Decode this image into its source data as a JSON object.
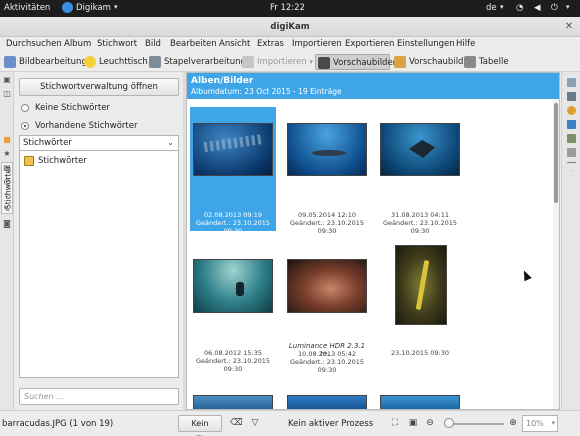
{
  "topbar": {
    "activities": "Aktivitäten",
    "app_name": "Digikam",
    "clock": "Fr 12:22",
    "keyboard": "de"
  },
  "window": {
    "title": "digiKam"
  },
  "menu": [
    "Durchsuchen",
    "Album",
    "Stichwort",
    "Bild",
    "Bearbeiten",
    "Ansicht",
    "Extras",
    "Importieren",
    "Exportieren",
    "Einstellungen",
    "Hilfe"
  ],
  "toolbar": {
    "image_editor": "Bildbearbeitung",
    "light_table": "Leuchttisch",
    "batch": "Stapelverarbeitung",
    "import": "Importieren",
    "preview_thumbs": "Vorschaubilder",
    "preview": "Vorschaubild",
    "table": "Tabelle"
  },
  "left_tab": {
    "label": "Stichwörter"
  },
  "left_panel": {
    "manage_button": "Stichwortverwaltung öffnen",
    "radio_none": "Keine Stichwörter",
    "radio_existing": "Vorhandene Stichwörter",
    "select_value": "Stichwörter",
    "tree_root": "Stichwörter",
    "search_placeholder": "Suchen ..."
  },
  "album": {
    "title": "Alben/Bilder",
    "subtitle": "Albumdatum: 23 Oct 2015 - 19 Einträge"
  },
  "thumbnails": [
    {
      "date": "02.08.2013 09:19",
      "changed": "Geändert.: 23.10.2015 09:30"
    },
    {
      "date": "09.05.2014 12:10",
      "changed": "Geändert.: 23.10.2015 09:30"
    },
    {
      "date": "31.08.2013 04:11",
      "changed": "Geändert.: 23.10.2015 09:30"
    },
    {
      "date": "06.08.2012 15:35",
      "changed": "Geändert.: 23.10.2015 09:30"
    },
    {
      "title": "Luminance HDR 2.3.1 te...",
      "date": "10.08.2013 05:42",
      "changed": "Geändert.: 23.10.2015 09:30"
    },
    {
      "date": "23.10.2015 09:30"
    }
  ],
  "status": {
    "file": "barracudas.JPG (1 von 19)",
    "filter": "Kein ...ilter",
    "process": "Kein aktiver Prozess",
    "zoom": "10%"
  }
}
